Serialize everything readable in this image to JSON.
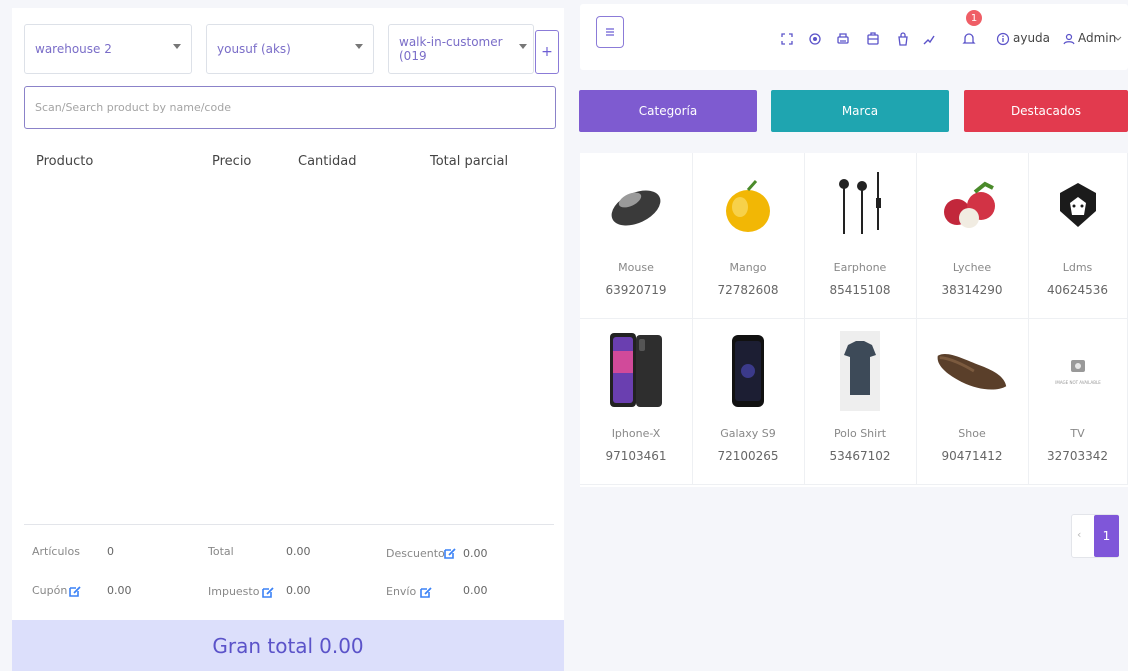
{
  "left": {
    "warehouse": "warehouse 2",
    "user": "yousuf (aks)",
    "customer": "walk-in-customer (019",
    "add_label": "+",
    "search_placeholder": "Scan/Search product by name/code",
    "table_headers": [
      "Producto",
      "Precio",
      "Cantidad",
      "Total parcial"
    ],
    "summary": {
      "articulos_label": "Artículos",
      "articulos_value": "0",
      "total_label": "Total",
      "total_value": "0.00",
      "descuento_label": "Descuento",
      "descuento_value": "0.00",
      "cupon_label": "Cupón",
      "cupon_value": "0.00",
      "impuesto_label": "Impuesto",
      "impuesto_value": "0.00",
      "envio_label": "Envío",
      "envio_value": "0.00"
    },
    "grand_total_label": "Gran total",
    "grand_total_value": "0.00"
  },
  "topbar": {
    "menu_icon": "hamburger-icon",
    "icons": [
      "fullscreen-icon",
      "globe-icon",
      "printer-icon",
      "calculator-icon",
      "bag-icon",
      "chart-line-icon",
      "bell-icon"
    ],
    "notification_count": "1",
    "help_label": "ayuda",
    "user_label": "Admin"
  },
  "categories": [
    {
      "label": "Categoría",
      "color": "#7e5bd0"
    },
    {
      "label": "Marca",
      "color": "#1fa5b0"
    },
    {
      "label": "Destacados",
      "color": "#e23a4e"
    }
  ],
  "products": [
    {
      "name": "Mouse",
      "code": "63920719"
    },
    {
      "name": "Mango",
      "code": "72782608"
    },
    {
      "name": "Earphone",
      "code": "85415108"
    },
    {
      "name": "Lychee",
      "code": "38314290"
    },
    {
      "name": "Ldms",
      "code": "40624536"
    },
    {
      "name": "Iphone-X",
      "code": "97103461"
    },
    {
      "name": "Galaxy S9",
      "code": "72100265"
    },
    {
      "name": "Polo Shirt",
      "code": "53467102"
    },
    {
      "name": "Shoe",
      "code": "90471412"
    },
    {
      "name": "TV",
      "code": "32703342"
    }
  ],
  "image_not_available_text": "IMAGE NOT AVAILABLE",
  "pagination": {
    "prev": "‹",
    "current": "1"
  }
}
